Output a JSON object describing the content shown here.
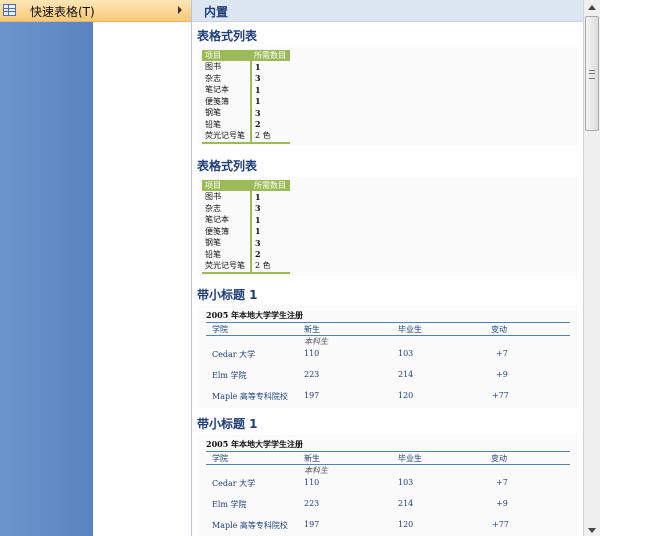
{
  "menu": {
    "label": "快速表格(T)",
    "icon": "table-icon",
    "submenu_icon": "chevron-right-icon"
  },
  "gallery": {
    "header": "内置",
    "items": [
      {
        "title": "表格式列表",
        "table": {
          "headers": [
            "项目",
            "所需数目"
          ],
          "rows": [
            [
              "图书",
              "1"
            ],
            [
              "杂志",
              "3"
            ],
            [
              "笔记本",
              "1"
            ],
            [
              "便笺簿",
              "1"
            ],
            [
              "钢笔",
              "3"
            ],
            [
              "铅笔",
              "2"
            ],
            [
              "荧光记号笔",
              "2 色"
            ]
          ]
        }
      },
      {
        "title": "表格式列表",
        "table": {
          "headers": [
            "项目",
            "所需数目"
          ],
          "rows": [
            [
              "图书",
              "1"
            ],
            [
              "杂志",
              "3"
            ],
            [
              "笔记本",
              "1"
            ],
            [
              "便笺簿",
              "1"
            ],
            [
              "钢笔",
              "3"
            ],
            [
              "铅笔",
              "2"
            ],
            [
              "荧光记号笔",
              "2 色"
            ]
          ]
        }
      },
      {
        "title": "带小标题 1",
        "caption": "2005 年本地大学学生注册",
        "headers": [
          "学院",
          "新生",
          "毕业生",
          "变动"
        ],
        "subheader": "本科生",
        "rows": [
          [
            "Cedar 大学",
            "110",
            "103",
            "+7"
          ],
          [
            "Elm 学院",
            "223",
            "214",
            "+9"
          ],
          [
            "Maple 高等专科院校",
            "197",
            "120",
            "+77"
          ]
        ]
      },
      {
        "title": "带小标题 1",
        "caption": "2005 年本地大学学生注册",
        "headers": [
          "学院",
          "新生",
          "毕业生",
          "变动"
        ],
        "subheader": "本科生",
        "rows": [
          [
            "Cedar 大学",
            "110",
            "103",
            "+7"
          ],
          [
            "Elm 学院",
            "223",
            "214",
            "+9"
          ],
          [
            "Maple 高等专科院校",
            "197",
            "120",
            "+77"
          ]
        ]
      }
    ]
  },
  "scrollbar": {
    "up_icon": "scroll-up-arrow-icon",
    "down_icon": "scroll-down-arrow-icon"
  }
}
